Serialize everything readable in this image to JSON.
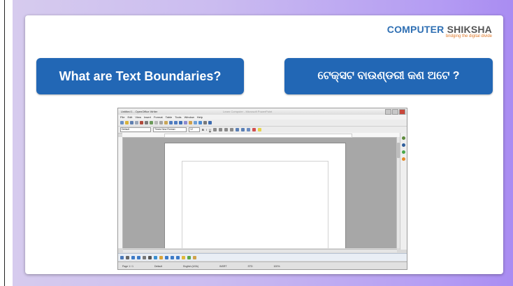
{
  "brand": {
    "name_main": "COMPUTER",
    "name_sub": "SHIKSHA",
    "tagline": "bridging the digital divide"
  },
  "heading_english": "What are Text Boundaries?",
  "heading_odia": "ଟେକ୍ସଟ ବାଉଣ୍ଡରୀ କଣ ଅଟେ ?",
  "screenshot": {
    "window_title": "Untitled 1 - OpenOffice Writer",
    "window_title_center": "Learn Computer - Microsoft PowerPoint",
    "menu": [
      "File",
      "Edit",
      "View",
      "Insert",
      "Format",
      "Table",
      "Tools",
      "Window",
      "Help"
    ],
    "style_value": "Default",
    "font_value": "Times New Roman",
    "size_value": "12",
    "format_buttons": [
      "B",
      "I",
      "U"
    ],
    "status": [
      "Page 1 / 1",
      "Default",
      "English (USA)",
      "INSRT",
      "STD",
      "100%"
    ]
  },
  "colors": {
    "heading_bg": "#2267b5",
    "brand_blue": "#2e6fb3",
    "tagline_orange": "#e07a2a"
  }
}
